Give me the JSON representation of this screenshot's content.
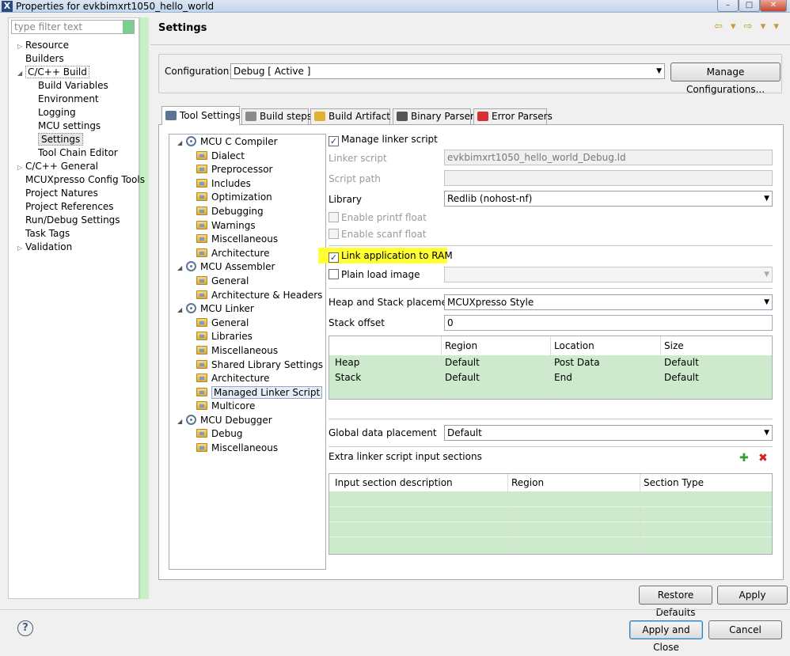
{
  "window": {
    "title": "Properties for evkbimxrt1050_hello_world",
    "min": "–",
    "max": "□",
    "close": "✕"
  },
  "filter": {
    "placeholder": "type filter text"
  },
  "nav": [
    {
      "label": "Resource",
      "level": 0,
      "twisty": "▷"
    },
    {
      "label": "Builders",
      "level": 0,
      "twisty": ""
    },
    {
      "label": "C/C++ Build",
      "level": 0,
      "twisty": "◢",
      "selected_box": true
    },
    {
      "label": "Build Variables",
      "level": 1,
      "twisty": ""
    },
    {
      "label": "Environment",
      "level": 1,
      "twisty": ""
    },
    {
      "label": "Logging",
      "level": 1,
      "twisty": ""
    },
    {
      "label": "MCU settings",
      "level": 1,
      "twisty": ""
    },
    {
      "label": "Settings",
      "level": 1,
      "twisty": "",
      "selected": true
    },
    {
      "label": "Tool Chain Editor",
      "level": 1,
      "twisty": ""
    },
    {
      "label": "C/C++ General",
      "level": 0,
      "twisty": "▷"
    },
    {
      "label": "MCUXpresso Config Tools",
      "level": 0,
      "twisty": ""
    },
    {
      "label": "Project Natures",
      "level": 0,
      "twisty": ""
    },
    {
      "label": "Project References",
      "level": 0,
      "twisty": ""
    },
    {
      "label": "Run/Debug Settings",
      "level": 0,
      "twisty": ""
    },
    {
      "label": "Task Tags",
      "level": 0,
      "twisty": ""
    },
    {
      "label": "Validation",
      "level": 0,
      "twisty": "▷"
    }
  ],
  "header": {
    "title": "Settings",
    "nav_arrows": "⇦ ▾ ⇨ ▾ ▾"
  },
  "config": {
    "label": "Configuration:",
    "value": "Debug  [ Active ]",
    "manage_button": "Manage Configurations..."
  },
  "tabs": [
    {
      "label": "Tool Settings",
      "active": true,
      "icon_color": "#5a7694"
    },
    {
      "label": "Build steps",
      "active": false,
      "icon_color": "#8a8a8a"
    },
    {
      "label": "Build Artifact",
      "active": false,
      "icon_color": "#e0b030"
    },
    {
      "label": "Binary Parsers",
      "active": false,
      "icon_color": "#555555"
    },
    {
      "label": "Error Parsers",
      "active": false,
      "icon_color": "#d83030"
    }
  ],
  "tree": [
    {
      "label": "MCU C Compiler",
      "type": "tool"
    },
    {
      "label": "Dialect",
      "type": "opt"
    },
    {
      "label": "Preprocessor",
      "type": "opt"
    },
    {
      "label": "Includes",
      "type": "opt"
    },
    {
      "label": "Optimization",
      "type": "opt"
    },
    {
      "label": "Debugging",
      "type": "opt"
    },
    {
      "label": "Warnings",
      "type": "opt"
    },
    {
      "label": "Miscellaneous",
      "type": "opt"
    },
    {
      "label": "Architecture",
      "type": "opt"
    },
    {
      "label": "MCU Assembler",
      "type": "tool"
    },
    {
      "label": "General",
      "type": "opt"
    },
    {
      "label": "Architecture & Headers",
      "type": "opt"
    },
    {
      "label": "MCU Linker",
      "type": "tool"
    },
    {
      "label": "General",
      "type": "opt"
    },
    {
      "label": "Libraries",
      "type": "opt"
    },
    {
      "label": "Miscellaneous",
      "type": "opt"
    },
    {
      "label": "Shared Library Settings",
      "type": "opt"
    },
    {
      "label": "Architecture",
      "type": "opt"
    },
    {
      "label": "Managed Linker Script",
      "type": "opt",
      "selected": true
    },
    {
      "label": "Multicore",
      "type": "opt"
    },
    {
      "label": "MCU Debugger",
      "type": "tool"
    },
    {
      "label": "Debug",
      "type": "opt"
    },
    {
      "label": "Miscellaneous",
      "type": "opt"
    }
  ],
  "form": {
    "manage_linker_script": {
      "label": "Manage linker script",
      "checked": true
    },
    "linker_script": {
      "label": "Linker script",
      "value": "evkbimxrt1050_hello_world_Debug.ld"
    },
    "script_path": {
      "label": "Script path",
      "value": ""
    },
    "library": {
      "label": "Library",
      "value": "Redlib (nohost-nf)"
    },
    "enable_printf_float": {
      "label": "Enable printf float",
      "checked": false
    },
    "enable_scanf_float": {
      "label": "Enable scanf float",
      "checked": false
    },
    "link_to_ram": {
      "label": "Link application to RAM",
      "checked": true
    },
    "plain_load_image": {
      "label": "Plain load image",
      "checked": false,
      "value": ""
    },
    "heap_stack_placement": {
      "label": "Heap and Stack placement",
      "value": "MCUXpresso Style"
    },
    "stack_offset": {
      "label": "Stack offset",
      "value": "0"
    },
    "global_data_placement": {
      "label": "Global data placement",
      "value": "Default"
    },
    "extra_sections_label": "Extra linker script input sections",
    "checkmark": "✓"
  },
  "heap_table": {
    "columns": [
      "",
      "Region",
      "Location",
      "Size"
    ],
    "rows": [
      [
        "Heap",
        "Default",
        "Post Data",
        "Default"
      ],
      [
        "Stack",
        "Default",
        "End",
        "Default"
      ]
    ]
  },
  "extra_table": {
    "columns": [
      "Input section description",
      "Region",
      "Section Type"
    ]
  },
  "icons": {
    "add": "✚",
    "remove": "✖",
    "help": "?"
  },
  "buttons": {
    "restore_defaults": "Restore Defaults",
    "apply": "Apply",
    "apply_close": "Apply and Close",
    "cancel": "Cancel"
  }
}
